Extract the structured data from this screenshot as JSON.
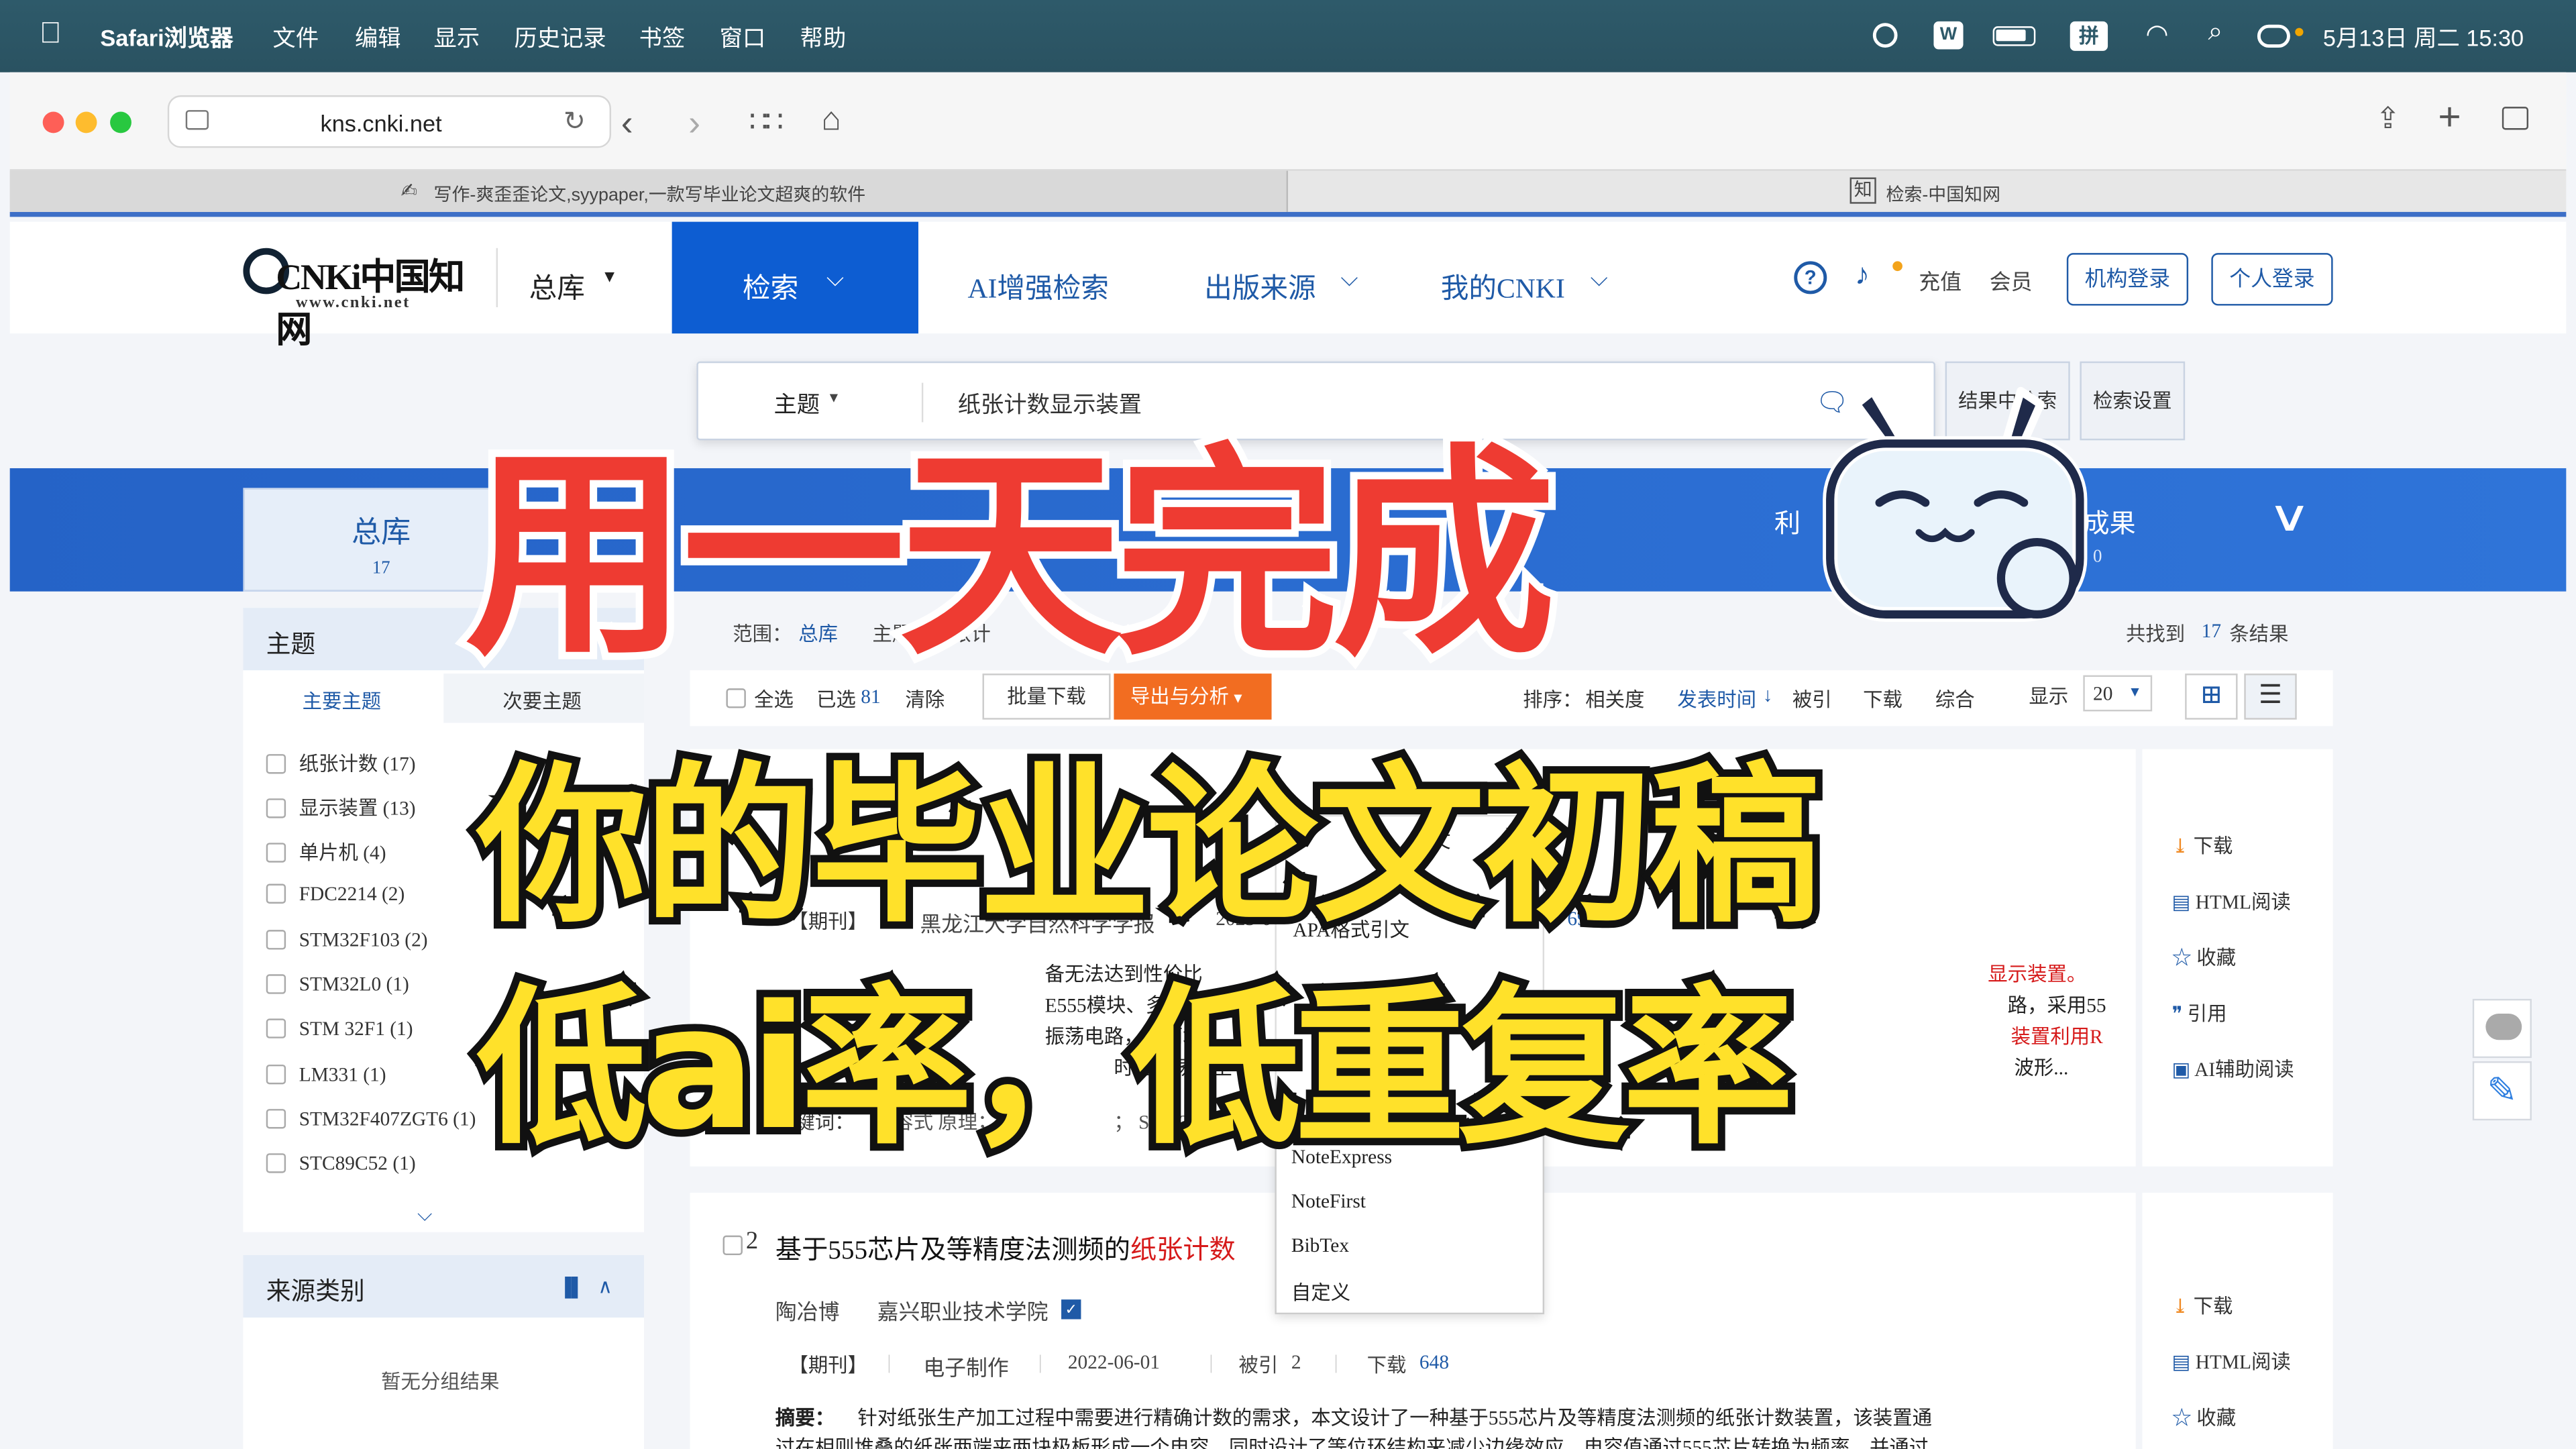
{
  "menubar": {
    "apple": "",
    "app": "Safari浏览器",
    "items": [
      "文件",
      "编辑",
      "显示",
      "历史记录",
      "书签",
      "窗口",
      "帮助"
    ],
    "ime": "拼",
    "date_time": "5月13日 周二  15:30"
  },
  "browser": {
    "url": "kns.cnki.net",
    "tabs": [
      {
        "label": "写作-爽歪歪论文,syypaper,一款写毕业论文超爽的软件"
      },
      {
        "label": "检索-中国知网"
      }
    ]
  },
  "cnki": {
    "logo": "CNKi中国知网",
    "logo_url_text": "www.cnki.net",
    "db_select": "总库",
    "nav": [
      "检索",
      "AI增强检索",
      "出版来源",
      "我的CNKI"
    ],
    "links": [
      "充值",
      "会员"
    ],
    "buttons": [
      "机构登录",
      "个人登录"
    ]
  },
  "search": {
    "field": "主题",
    "query": "纸张计数显示装置",
    "buttons": [
      "结果中检索",
      "检索设置"
    ]
  },
  "band": {
    "zongku_label": "总库",
    "zongku_count": "17",
    "right_partial_1": "利",
    "right_partial_2": "成果",
    "right_partial_count": "0"
  },
  "left": {
    "panel_title": "主题",
    "tabs": [
      "主要主题",
      "次要主题"
    ],
    "items": [
      "纸张计数 (17)",
      "显示装置 (13)",
      "单片机 (4)",
      "FDC2214 (2)",
      "STM32F103 (2)",
      "STM32L0 (1)",
      "STM 32F1 (1)",
      "LM331 (1)",
      "STM32F407ZGT6 (1)",
      "STC89C52 (1)"
    ],
    "source_title": "来源类别",
    "source_empty": "暂无分组结果"
  },
  "summary": {
    "scope_label": "范围：",
    "scope": "总库",
    "topic_label": "主题：纸张计",
    "found_prefix": "共找到",
    "found_count": "17",
    "found_suffix": "条结果"
  },
  "ops": {
    "select_all": "全选",
    "selected_label": "已选",
    "selected_count": "81",
    "clear": "清除",
    "batch_download": "批量下载",
    "export": "导出与分析",
    "sort_label": "排序：",
    "sort_items": [
      "相关度",
      "发表时间",
      "被引",
      "下载",
      "综合"
    ],
    "display_label": "显示",
    "page_size": "20"
  },
  "result1": {
    "type": "【期刊】",
    "journal": "黑龙江大学自然科学学报",
    "year": "2023-0",
    "downloads": "692",
    "abs_frag_1": "备无法达到性价比",
    "abs_frag_2": "E555模块、多谐振",
    "abs_frag_3": "振荡电路，对两域",
    "abs_frag_4": "时器振荡产生",
    "abs_end_1": "显示装置。",
    "abs_end_2": "路，采用55",
    "abs_end_3": "装置利用R",
    "abs_end_4": "波形...",
    "kw_label": "关键词：",
    "kw_frag": "电容式   原理；  纸",
    "kw_frag_2": "；  STM32单片"
  },
  "dropdown": {
    "frag_top": "引文",
    "apa": "APA格式引文",
    "items": [
      "NoteExpress",
      "NoteFirst",
      "BibTex",
      "自定义"
    ]
  },
  "result2": {
    "index": "2",
    "title_pre": "基于555芯片及等精度法测频的",
    "title_hl": "纸张计数",
    "author": "陶冶博",
    "org": "嘉兴职业技术学院",
    "type": "【期刊】",
    "journal": "电子制作",
    "date": "2022-06-01",
    "cited_label": "被引",
    "cited": "2",
    "download_label": "下载",
    "downloads": "648",
    "abstract_label": "摘要：",
    "abstract_line1": "针对纸张生产加工过程中需要进行精确计数的需求，本文设计了一种基于555芯片及等精度法测频的纸张计数装置，该装置通",
    "abstract_line2": "过在相则堆叠的纸张两端夹两块极板形成一个电容，同时设计了等位环结构来减少边缘效应，电容值通过555芯片转换为频率，并通过"
  },
  "side_actions": [
    "下载",
    "HTML阅读",
    "收藏",
    "引用",
    "AI辅助阅读"
  ],
  "overlay": {
    "line1": "用一天完成",
    "line2": "你的毕业论文初稿",
    "line3": "低ai率，低重复率"
  },
  "colors": {
    "cnki_blue": "#0d5dd2",
    "link_blue": "#1f5aa7",
    "highlight_red": "#d61a1a",
    "export_orange": "#f26d21",
    "overlay_red": "#ee3b32",
    "overlay_yellow": "#ffe12a"
  }
}
